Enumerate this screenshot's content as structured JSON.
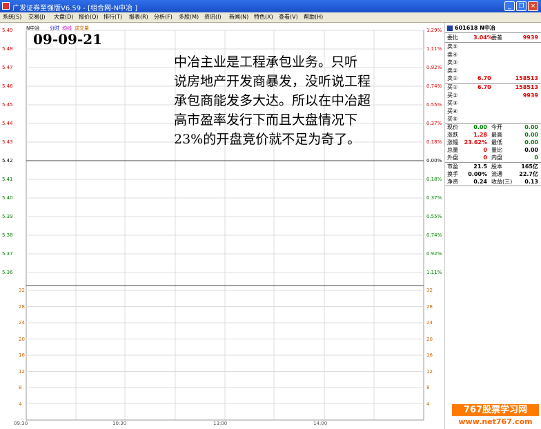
{
  "window": {
    "title": "广发证券至强版V6.59 - [组合网-N中冶 ]",
    "buttons": {
      "minimize": "_",
      "restore": "❐",
      "close": "×"
    }
  },
  "menu": [
    "系统(S)",
    "交易(J)",
    "大盘(D)",
    "报价(Q)",
    "排行(T)",
    "报表(R)",
    "分析(F)",
    "多股(M)",
    "资讯(I)",
    "新闻(N)",
    "特色(X)",
    "查看(V)",
    "帮助(H)"
  ],
  "chart": {
    "stock_name": "N中冶",
    "tabs": {
      "timeshare": "分时",
      "avg_price": "均线",
      "volume": "成交量"
    },
    "date_label": "09-09-21",
    "note_lines": [
      "中冶主业是工程承包业务。只听",
      "说房地产开发商暴发，没听说工程",
      "承包商能发多大达。所以在中冶超",
      "高市盈率发行下而且大盘情况下",
      "23%的开盘竞价就不足为奇了。"
    ],
    "price_axis_left": [
      "5.49",
      "5.48",
      "5.47",
      "5.46",
      "5.45",
      "5.44",
      "5.43",
      "5.42",
      "5.41",
      "5.40",
      "5.39",
      "5.38",
      "5.37",
      "5.36"
    ],
    "price_axis_right": [
      "1.29%",
      "1.11%",
      "0.92%",
      "0.74%",
      "0.55%",
      "0.37%",
      "0.18%",
      "0.00%",
      "0.18%",
      "0.37%",
      "0.55%",
      "0.74%",
      "0.92%",
      "1.11%"
    ],
    "volume_axis_left": [
      "32",
      "28",
      "24",
      "20",
      "16",
      "12",
      "8",
      "4"
    ],
    "volume_axis_right": [
      "32",
      "28",
      "24",
      "20",
      "16",
      "12",
      "8",
      "4"
    ],
    "time_labels": [
      "09:30",
      "10:30",
      "13:00",
      "14:00"
    ],
    "colors": {
      "up": "#e00000",
      "down": "#008000",
      "flat": "#000000",
      "grid": "#dcdcdc",
      "axis": "#9a9a9a"
    }
  },
  "info": {
    "header": "601618 N中冶",
    "weibi": {
      "label": "委比",
      "value": "3.04%",
      "label2": "委差",
      "value2": "9939"
    },
    "asks": [
      {
        "label": "卖⑤",
        "price": "",
        "vol": ""
      },
      {
        "label": "卖④",
        "price": "",
        "vol": ""
      },
      {
        "label": "卖③",
        "price": "",
        "vol": ""
      },
      {
        "label": "卖②",
        "price": "",
        "vol": ""
      },
      {
        "label": "卖①",
        "price": "6.70",
        "vol": "158513"
      }
    ],
    "bids": [
      {
        "label": "买①",
        "price": "6.70",
        "vol": "158513"
      },
      {
        "label": "买②",
        "price": "",
        "vol": "9939"
      },
      {
        "label": "买③",
        "price": "",
        "vol": ""
      },
      {
        "label": "买④",
        "price": "",
        "vol": ""
      },
      {
        "label": "买⑤",
        "price": "",
        "vol": ""
      }
    ],
    "stats": [
      {
        "l1": "现价",
        "v1": "0.00",
        "l2": "今开",
        "v2": "0.00",
        "c1": "green",
        "c2": "green"
      },
      {
        "l1": "涨跌",
        "v1": "1.28",
        "l2": "最高",
        "v2": "0.00",
        "c1": "red",
        "c2": "green"
      },
      {
        "l1": "涨幅",
        "v1": "23.62%",
        "l2": "最低",
        "v2": "0.00",
        "c1": "red",
        "c2": "green"
      },
      {
        "l1": "总量",
        "v1": "0",
        "l2": "量比",
        "v2": "0.00",
        "c1": "red",
        "c2": "black"
      },
      {
        "l1": "外盘",
        "v1": "0",
        "l2": "内盘",
        "v2": "0",
        "c1": "red",
        "c2": "green"
      }
    ],
    "fundamentals": [
      {
        "l1": "市盈",
        "v1": "21.5",
        "l2": "股本",
        "v2": "165亿"
      },
      {
        "l1": "换手",
        "v1": "0.00%",
        "l2": "流通",
        "v2": "22.7亿"
      },
      {
        "l1": "净资",
        "v1": "0.24",
        "l2": "收益(三)",
        "v2": "0.13"
      }
    ]
  },
  "watermark": {
    "line1": "767股票学习网",
    "line2": "www.net767.com"
  }
}
